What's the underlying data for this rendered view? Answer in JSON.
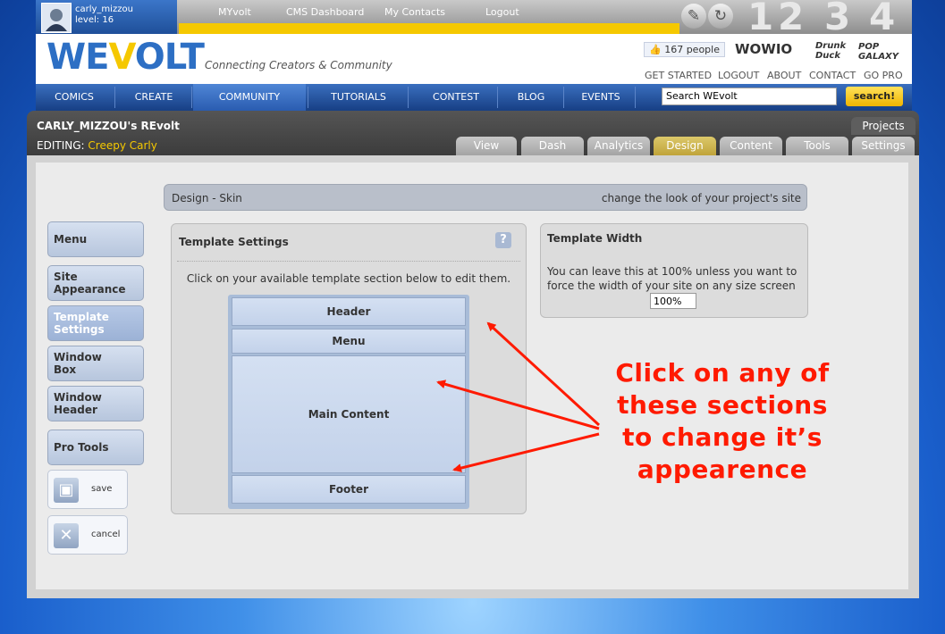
{
  "topbar": {
    "username": "carly_mizzou",
    "level": "level: 16",
    "links": [
      "MYvolt",
      "CMS Dashboard",
      "My Contacts",
      "Logout"
    ],
    "tab_numbers": [
      "1",
      "2",
      "3",
      "4"
    ],
    "accent_color": "#f5c800"
  },
  "logo": {
    "text_a": "WE",
    "text_b": "V",
    "text_c": "OLT",
    "tagline": "Connecting Creators & Community"
  },
  "social": {
    "likes": "167 people"
  },
  "partners": [
    "WOWIO",
    "Drunk Duck",
    "POP GALAXY"
  ],
  "header_links": [
    "GET STARTED",
    "LOGOUT",
    "ABOUT",
    "CONTACT",
    "GO PRO"
  ],
  "nav": {
    "items": [
      "COMICS",
      "CREATE",
      "COMMUNITY",
      "TUTORIALS",
      "CONTEST",
      "BLOG",
      "EVENTS"
    ],
    "search_value": "Search WEvolt",
    "search_button": "search!"
  },
  "project": {
    "title": "CARLY_MIZZOU's REvolt",
    "editing_label": "EDITING:",
    "project_name": "Creepy Carly",
    "projects_tab": "Projects",
    "tabs": [
      "View",
      "Dash",
      "Analytics",
      "Design",
      "Content",
      "Tools",
      "Settings"
    ],
    "active_tab": "Design"
  },
  "skin_bar": {
    "left": "Design - Skin",
    "right": "change the look of your project's site"
  },
  "sidebar": {
    "items": [
      "Menu",
      "Site Appearance",
      "Template Settings",
      "Window Box",
      "Window Header",
      "Pro Tools"
    ],
    "save": "save",
    "cancel": "cancel"
  },
  "template_panel": {
    "title": "Template Settings",
    "help": "?",
    "instructions": "Click on your available template section below to edit them.",
    "sections": [
      "Header",
      "Menu",
      "Main Content",
      "Footer"
    ]
  },
  "width_panel": {
    "title": "Template Width",
    "description": "You can leave this at 100% unless you want to force the width of your site on any size screen",
    "value": "100%"
  },
  "callout": {
    "lines": [
      "Click on any of",
      "these sections",
      "to change it’s",
      "appearence"
    ],
    "color": "#ff1a00"
  }
}
